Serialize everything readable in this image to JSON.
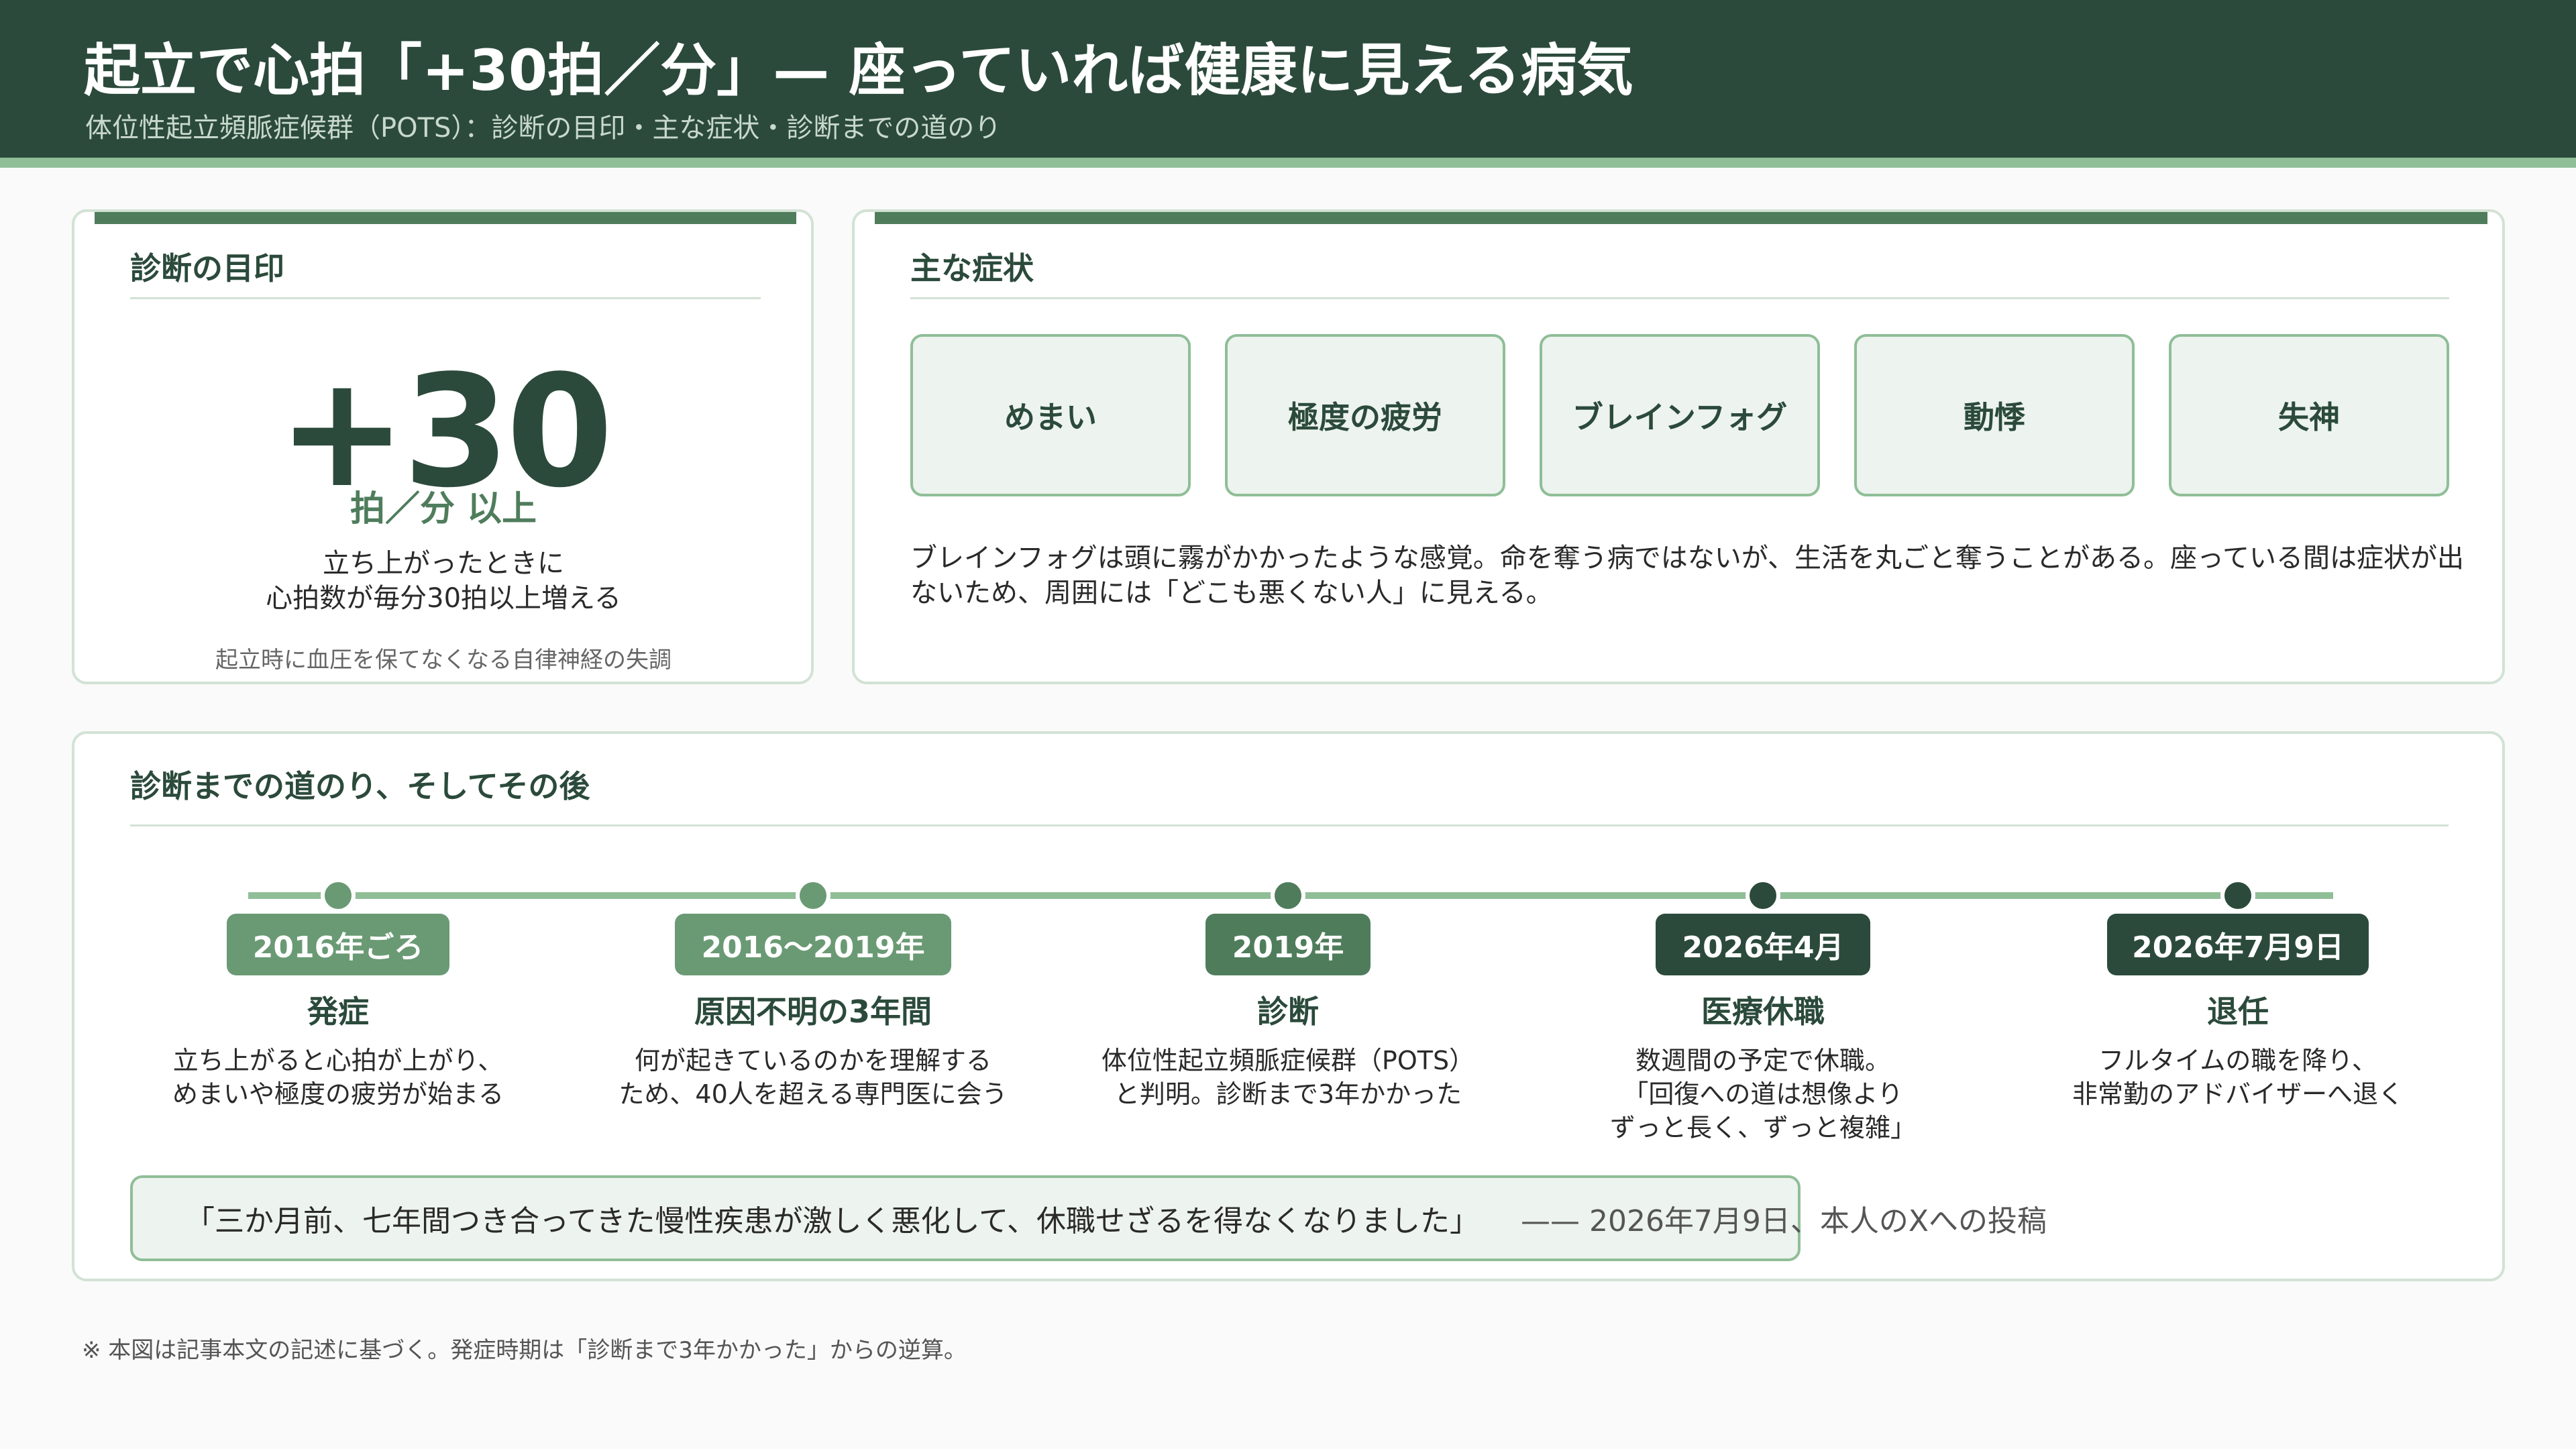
{
  "header": {
    "title": "起立で心拍「+30拍／分」— 座っていれば健康に見える病気",
    "subtitle": "体位性起立頻脈症候群（POTS）：診断の目印・主な症状・診断までの道のり"
  },
  "criteria": {
    "title": "診断の目印",
    "value": "+30",
    "unit": "拍／分 以上",
    "desc_line1": "立ち上がったときに",
    "desc_line2": "心拍数が毎分30拍以上増える",
    "note": "起立時に血圧を保てなくなる自律神経の失調"
  },
  "symptoms": {
    "title": "主な症状",
    "items": [
      {
        "label": "めまい"
      },
      {
        "label": "極度の疲労"
      },
      {
        "label": "ブレインフォグ"
      },
      {
        "label": "動悸"
      },
      {
        "label": "失神"
      }
    ],
    "note": "ブレインフォグは頭に霧がかかったような感覚。命を奪う病ではないが、生活を丸ごと奪うことがある。座っている間は症状が出ないため、周囲には「どこも悪くない人」に見える。"
  },
  "timeline": {
    "title": "診断までの道のり、そしてその後",
    "events": [
      {
        "date": "2016年ごろ",
        "title": "発症",
        "desc_lines": [
          "立ち上がると心拍が上がり、",
          "めまいや極度の疲労が始まる"
        ],
        "color": "#6a9a74"
      },
      {
        "date": "2016〜2019年",
        "title": "原因不明の3年間",
        "desc_lines": [
          "何が起きているのかを理解する",
          "ため、40人を超える専門医に会う"
        ],
        "color": "#6a9a74"
      },
      {
        "date": "2019年",
        "title": "診断",
        "desc_lines": [
          "体位性起立頻脈症候群（POTS）",
          "と判明。診断まで3年かかった"
        ],
        "color": "#4f7d5c"
      },
      {
        "date": "2026年4月",
        "title": "医療休職",
        "desc_lines": [
          "数週間の予定で休職。",
          "「回復への道は想像より",
          "ずっと長く、ずっと複雑」"
        ],
        "color": "#2b4a3b"
      },
      {
        "date": "2026年7月9日",
        "title": "退任",
        "desc_lines": [
          "フルタイムの職を降り、",
          "非常勤のアドバイザーへ退く"
        ],
        "color": "#2b4a3b"
      }
    ],
    "quote": "「三か月前、七年間つき合ってきた慢性疾患が激しく悪化して、休職せざるを得なくなりました」",
    "quote_source": "—— 2026年7月9日、本人のXへの投稿"
  },
  "footnote": "※ 本図は記事本文の記述に基づく。発症時期は「診断まで3年かかった」からの逆算。"
}
